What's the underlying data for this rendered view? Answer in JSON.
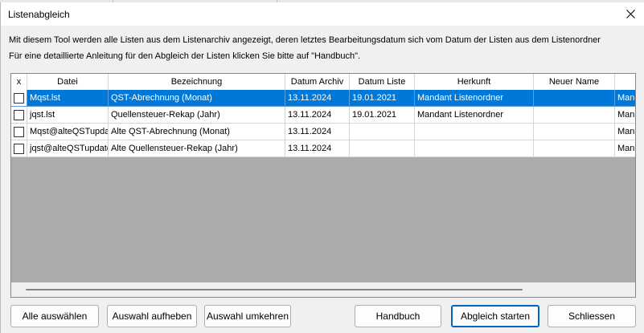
{
  "window": {
    "title": "Listenabgleich"
  },
  "description": {
    "line1": "Mit diesem Tool werden alle Listen aus dem Listenarchiv angezeigt, deren letztes Bearbeitungsdatum sich vom Datum der Listen aus dem Listenordner",
    "line2": "Für eine detaillierte Anleitung für den Abgleich der Listen klicken Sie bitte auf \"Handbuch\"."
  },
  "table": {
    "columns": [
      "x",
      "Datei",
      "Bezeichnung",
      "Datum Archiv",
      "Datum Liste",
      "Herkunft",
      "Neuer Name",
      ""
    ],
    "rows": [
      {
        "checked": false,
        "selected": true,
        "datei": "Mqst.lst",
        "bezeichnung": "QST-Abrechnung (Monat)",
        "datum_archiv": "13.11.2024",
        "datum_liste": "19.01.2021",
        "herkunft": "Mandant Listenordner",
        "neuer_name": "",
        "extra": "Man"
      },
      {
        "checked": false,
        "selected": false,
        "datei": "jqst.lst",
        "bezeichnung": "Quellensteuer-Rekap (Jahr)",
        "datum_archiv": "13.11.2024",
        "datum_liste": "19.01.2021",
        "herkunft": "Mandant Listenordner",
        "neuer_name": "",
        "extra": "Man"
      },
      {
        "checked": false,
        "selected": false,
        "datei": "Mqst@alteQSTupda",
        "bezeichnung": "Alte QST-Abrechnung (Monat)",
        "datum_archiv": "13.11.2024",
        "datum_liste": "",
        "herkunft": "",
        "neuer_name": "",
        "extra": "Man"
      },
      {
        "checked": false,
        "selected": false,
        "datei": "jqst@alteQSTupdate",
        "bezeichnung": "Alte Quellensteuer-Rekap (Jahr)",
        "datum_archiv": "13.11.2024",
        "datum_liste": "",
        "herkunft": "",
        "neuer_name": "",
        "extra": "Man"
      }
    ]
  },
  "buttons": {
    "select_all": "Alle auswählen",
    "clear_selection": "Auswahl aufheben",
    "invert_selection": "Auswahl umkehren",
    "manual": "Handbuch",
    "start": "Abgleich starten",
    "close": "Schliessen"
  },
  "colors": {
    "selection": "#0078d7",
    "primary_border": "#0067c0"
  }
}
